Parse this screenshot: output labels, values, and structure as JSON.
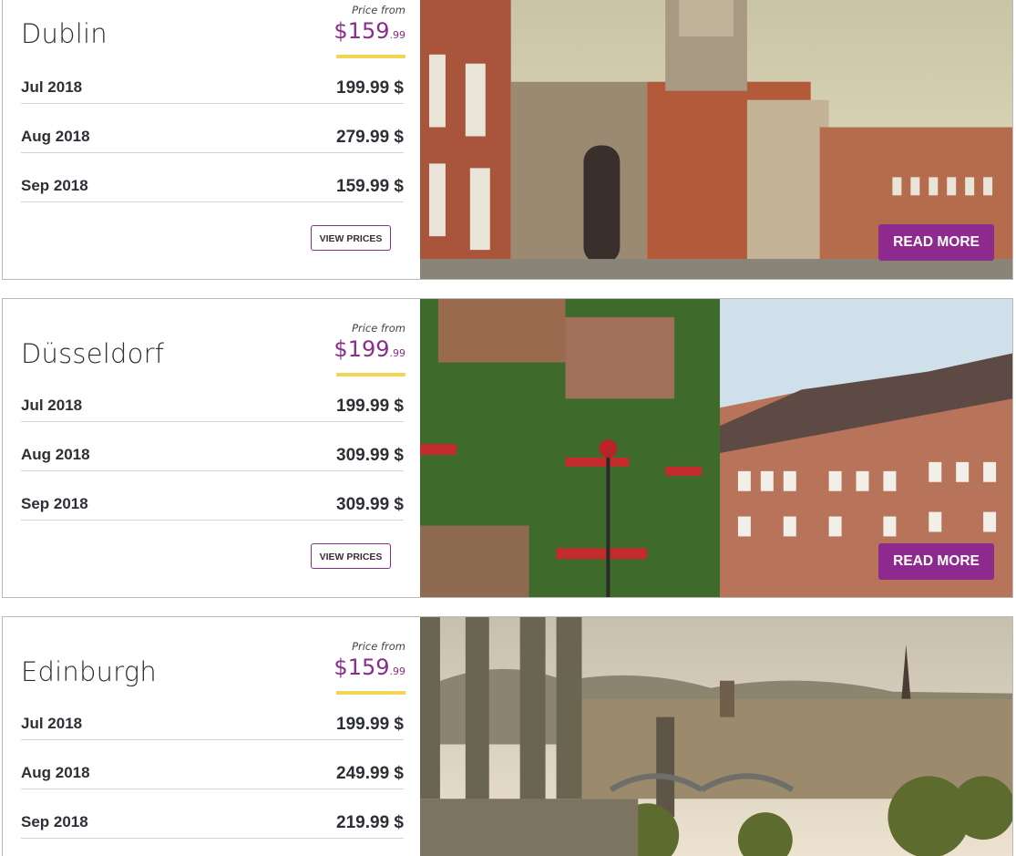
{
  "labels": {
    "price_from": "Price from",
    "view_prices": "VIEW PRICES",
    "read_more": "READ MORE"
  },
  "colors": {
    "accent": "#8e2a8d",
    "highlight": "#f2d554",
    "text": "#2d2f36"
  },
  "destinations": [
    {
      "city": "Dublin",
      "price_main": "$159",
      "price_cents": ".99",
      "rows": [
        {
          "month": "Jul 2018",
          "price": "199.99 $"
        },
        {
          "month": "Aug 2018",
          "price": "279.99 $"
        },
        {
          "month": "Sep 2018",
          "price": "159.99 $"
        }
      ]
    },
    {
      "city": "Düsseldorf",
      "price_main": "$199",
      "price_cents": ".99",
      "rows": [
        {
          "month": "Jul 2018",
          "price": "199.99 $"
        },
        {
          "month": "Aug 2018",
          "price": "309.99 $"
        },
        {
          "month": "Sep 2018",
          "price": "309.99 $"
        }
      ]
    },
    {
      "city": "Edinburgh",
      "price_main": "$159",
      "price_cents": ".99",
      "rows": [
        {
          "month": "Jul 2018",
          "price": "199.99 $"
        },
        {
          "month": "Aug 2018",
          "price": "249.99 $"
        },
        {
          "month": "Sep 2018",
          "price": "219.99 $"
        }
      ]
    }
  ]
}
